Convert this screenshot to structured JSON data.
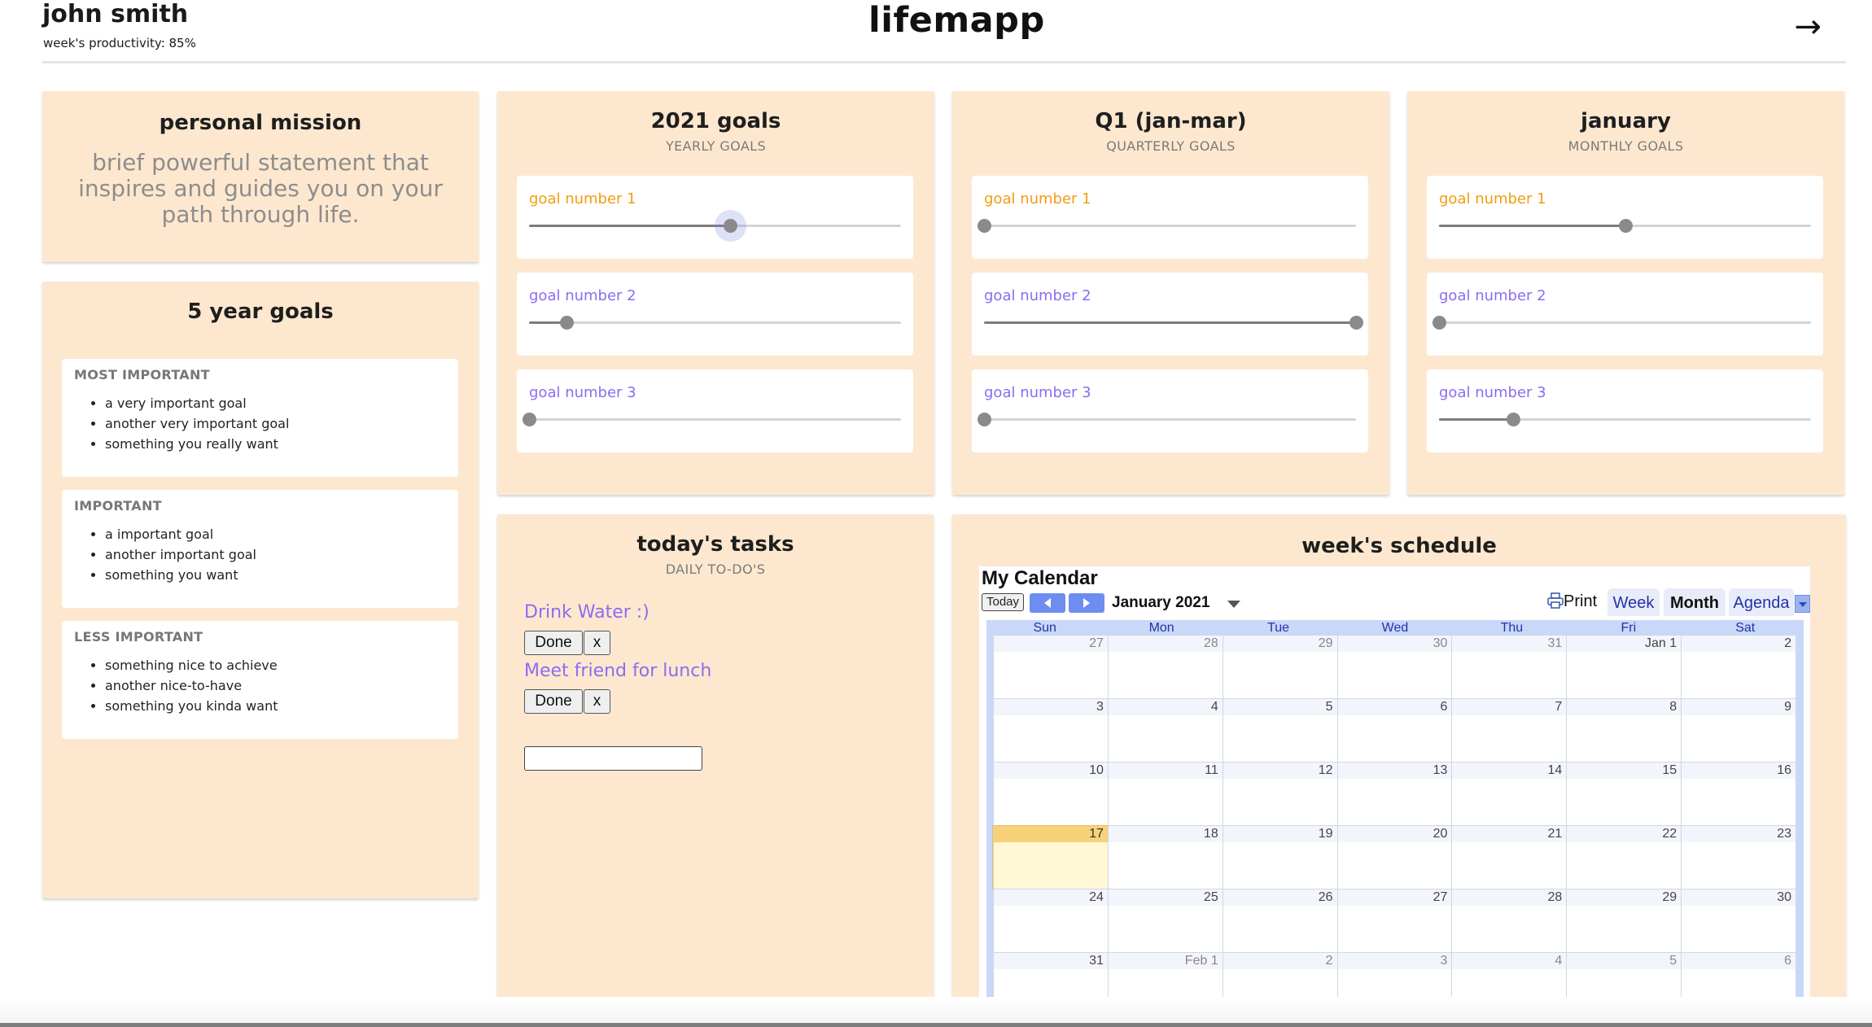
{
  "header": {
    "user_name": "john smith",
    "productivity": "week's productivity: 85%",
    "app_title": "lifemapp",
    "arrow": "→"
  },
  "mission": {
    "title": "personal mission",
    "text": "brief powerful statement that inspires and guides you on your path through life."
  },
  "five_year": {
    "title": "5 year goals",
    "sections": [
      {
        "heading": "MOST IMPORTANT",
        "items": [
          "a very important goal",
          "another very important goal",
          "something you really want"
        ]
      },
      {
        "heading": "IMPORTANT",
        "items": [
          "a important goal",
          "another important goal",
          "something you want"
        ]
      },
      {
        "heading": "LESS IMPORTANT",
        "items": [
          "something nice to achieve",
          "another nice-to-have",
          "something you kinda want"
        ]
      }
    ]
  },
  "goal_panels": [
    {
      "title": "2021 goals",
      "subtitle": "YEARLY GOALS",
      "goals": [
        {
          "label": "goal number 1",
          "progress": 0.54
        },
        {
          "label": "goal number 2",
          "progress": 0.1
        },
        {
          "label": "goal number 3",
          "progress": 0.0
        }
      ]
    },
    {
      "title": "Q1 (jan-mar)",
      "subtitle": "QUARTERLY GOALS",
      "goals": [
        {
          "label": "goal number 1",
          "progress": 0.0
        },
        {
          "label": "goal number 2",
          "progress": 1.0
        },
        {
          "label": "goal number 3",
          "progress": 0.0
        }
      ]
    },
    {
      "title": "january",
      "subtitle": "MONTHLY GOALS",
      "goals": [
        {
          "label": "goal number 1",
          "progress": 0.5
        },
        {
          "label": "goal number 2",
          "progress": 0.0
        },
        {
          "label": "goal number 3",
          "progress": 0.2
        }
      ]
    }
  ],
  "tasks": {
    "title": "today's tasks",
    "subtitle": "DAILY TO-DO'S",
    "items": [
      {
        "text": "Drink Water :)",
        "done_label": "Done",
        "remove_label": "x"
      },
      {
        "text": "Meet friend for lunch",
        "done_label": "Done",
        "remove_label": "x"
      }
    ],
    "input_value": ""
  },
  "schedule": {
    "title": "week's schedule",
    "calendar": {
      "name": "My Calendar",
      "today_label": "Today",
      "month_label": "January 2021",
      "print_label": "Print",
      "tabs": [
        "Week",
        "Month",
        "Agenda"
      ],
      "active_tab": "Month",
      "days_of_week": [
        "Sun",
        "Mon",
        "Tue",
        "Wed",
        "Thu",
        "Fri",
        "Sat"
      ],
      "weeks": [
        [
          "27",
          "28",
          "29",
          "30",
          "31",
          "Jan 1",
          "2"
        ],
        [
          "3",
          "4",
          "5",
          "6",
          "7",
          "8",
          "9"
        ],
        [
          "10",
          "11",
          "12",
          "13",
          "14",
          "15",
          "16"
        ],
        [
          "17",
          "18",
          "19",
          "20",
          "21",
          "22",
          "23"
        ],
        [
          "24",
          "25",
          "26",
          "27",
          "28",
          "29",
          "30"
        ],
        [
          "31",
          "Feb 1",
          "2",
          "3",
          "4",
          "5",
          "6"
        ]
      ],
      "today_cell": "17"
    }
  }
}
